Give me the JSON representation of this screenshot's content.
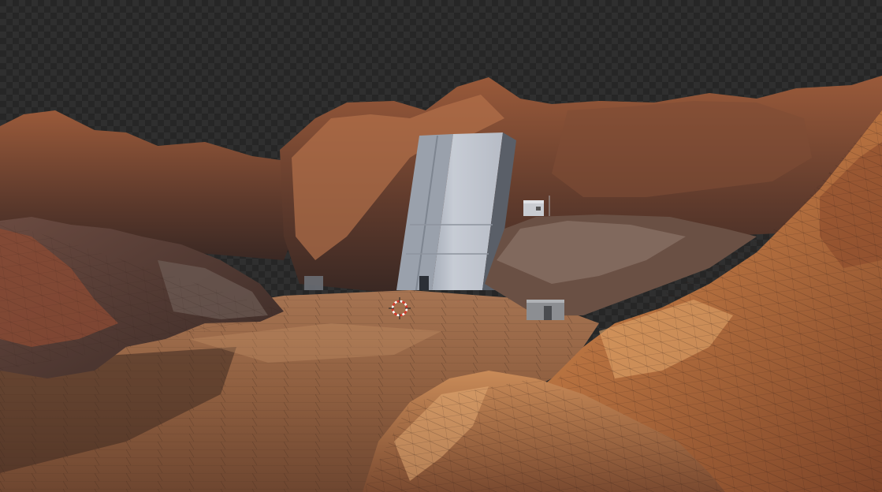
{
  "viewport": {
    "background": "transparent-checker",
    "render_mode": "rendered-with-wireframe-overlay",
    "scene_objects": [
      "rocky-canyon-terrain",
      "monolith-structure",
      "small-shed-upper",
      "small-shed-lower",
      "small-crate"
    ],
    "gizmo": "3d-cursor"
  },
  "colors": {
    "checker_dark": "#262626",
    "checker_light": "#2f2f2f",
    "rock_light": "#c98a55",
    "rock_mid": "#8a4f33",
    "rock_dark": "#3d2a25",
    "ground_sand": "#b58258",
    "monolith": "#c5cad3",
    "cursor_red": "#d43a2a"
  }
}
